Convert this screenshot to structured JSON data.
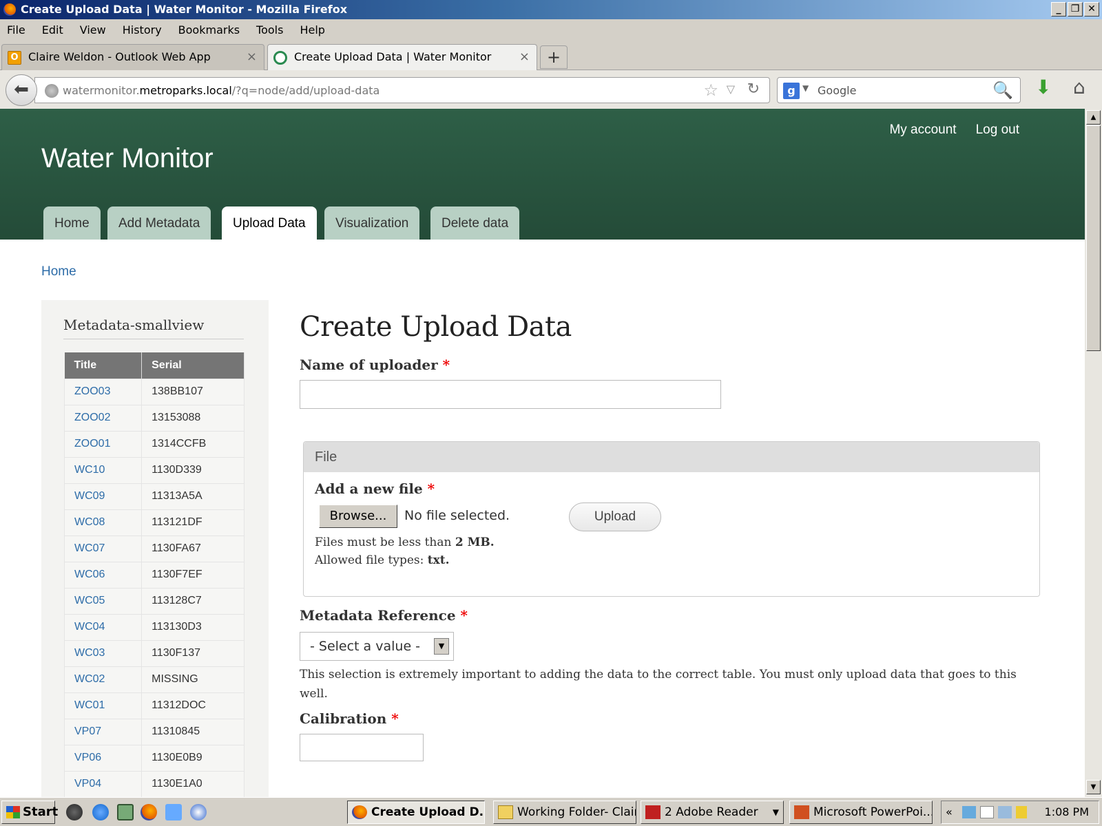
{
  "window": {
    "title": "Create Upload Data | Water Monitor - Mozilla Firefox",
    "controls": [
      "_",
      "❐",
      "✕"
    ]
  },
  "menu": [
    "File",
    "Edit",
    "View",
    "History",
    "Bookmarks",
    "Tools",
    "Help"
  ],
  "browser_tabs": [
    {
      "label": "Claire Weldon - Outlook Web App",
      "close": "×",
      "icon_glyph": "O"
    },
    {
      "label": "Create Upload Data | Water Monitor",
      "close": "×"
    }
  ],
  "new_tab": "+",
  "address": {
    "prefix": "watermonitor.",
    "domain": "metroparks.local",
    "path": "/?q=node/add/upload-data"
  },
  "search": {
    "engine_glyph": "g",
    "placeholder": "Google"
  },
  "site": {
    "name": "Water Monitor",
    "secondary_nav": [
      "My account",
      "Log out"
    ],
    "main_tabs": [
      "Home",
      "Add Metadata",
      "Upload Data",
      "Visualization",
      "Delete data"
    ],
    "active_tab": "Upload Data",
    "breadcrumb": "Home"
  },
  "sidebar": {
    "title": "Metadata-smallview",
    "columns": [
      "Title",
      "Serial"
    ],
    "rows": [
      [
        "ZOO03",
        "138BB107"
      ],
      [
        "ZOO02",
        "13153088"
      ],
      [
        "ZOO01",
        "1314CCFB"
      ],
      [
        "WC10",
        "1130D339"
      ],
      [
        "WC09",
        "11313A5A"
      ],
      [
        "WC08",
        "113121DF"
      ],
      [
        "WC07",
        "1130FA67"
      ],
      [
        "WC06",
        "1130F7EF"
      ],
      [
        "WC05",
        "113128C7"
      ],
      [
        "WC04",
        "113130D3"
      ],
      [
        "WC03",
        "1130F137"
      ],
      [
        "WC02",
        "MISSING"
      ],
      [
        "WC01",
        "11312DOC"
      ],
      [
        "VP07",
        "11310845"
      ],
      [
        "VP06",
        "1130E0B9"
      ],
      [
        "VP04",
        "1130E1A0"
      ]
    ]
  },
  "form": {
    "heading": "Create Upload Data",
    "required_mark": "*",
    "uploader_label": "Name of uploader",
    "uploader_value": "",
    "file_legend": "File",
    "add_file_label": "Add a new file",
    "browse_label": "Browse...",
    "no_file_text": "No file selected.",
    "upload_label": "Upload",
    "size_help_prefix": "Files must be less than ",
    "size_help_value": "2 MB.",
    "types_help_prefix": "Allowed file types: ",
    "types_help_value": "txt.",
    "metadata_label": "Metadata Reference",
    "metadata_selected": "- Select a value -",
    "metadata_help": "This selection is extremely important to adding the data to the correct table. You must only upload data that goes to this well.",
    "calibration_label": "Calibration",
    "calibration_value": ""
  },
  "taskbar": {
    "start_label": "Start",
    "tasks": [
      {
        "label": "Create Upload D...",
        "active": true
      },
      {
        "label": "Working Folder- Claire",
        "active": false
      },
      {
        "label": "2 Adobe Reader",
        "active": false
      },
      {
        "label": "Microsoft PowerPoi...",
        "active": false
      }
    ],
    "clock": "1:08 PM"
  },
  "colors": {
    "header_green": "#2e5f47",
    "tab_inactive": "#b8d0c4",
    "link_blue": "#2d6ca8",
    "required_red": "#e00000",
    "table_header": "#757575"
  }
}
